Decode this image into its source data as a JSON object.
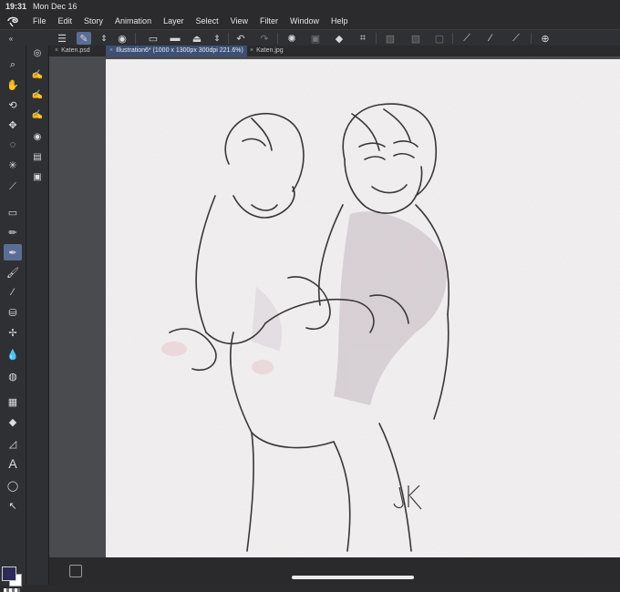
{
  "status_bar": {
    "time": "19:31",
    "date": "Mon Dec 16"
  },
  "menu": {
    "items": [
      "File",
      "Edit",
      "Story",
      "Animation",
      "Layer",
      "Select",
      "View",
      "Filter",
      "Window",
      "Help"
    ]
  },
  "tabs": [
    {
      "label": "Katen.psd",
      "active": false
    },
    {
      "label": "Illustration6* (1000 x 1300px 300dpi 221.6%)",
      "active": true
    },
    {
      "label": "Katen.jpg",
      "active": false
    }
  ],
  "tools": [
    "zoom-icon",
    "hand-icon",
    "rotate-icon",
    "move-icon",
    "lasso-icon",
    "magic-wand-icon",
    "eyedropper-icon",
    "eraser-icon",
    "pen-icon",
    "pencil-icon",
    "brush-icon",
    "line-icon",
    "airbrush-icon",
    "decoration-icon",
    "blend-icon",
    "watercolor-icon",
    "frame-icon",
    "fill-icon",
    "gradient-icon",
    "text-icon",
    "balloon-icon",
    "correct-line-icon"
  ],
  "colors": {
    "main_color": "#2d2a55",
    "sub_color": "#ffffff",
    "accent": "#5a6e95",
    "paper": "#f1eff0"
  },
  "artwork": {
    "signature": "JK"
  }
}
